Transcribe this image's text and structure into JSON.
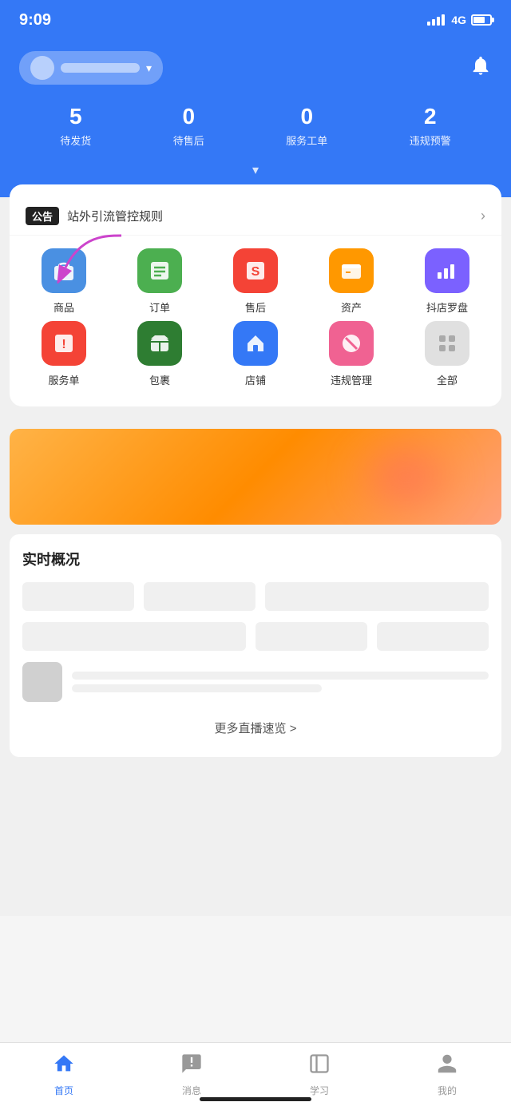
{
  "statusBar": {
    "time": "9:09",
    "signal": "4G"
  },
  "header": {
    "storeName": "",
    "bellLabel": "notifications",
    "stats": [
      {
        "number": "5",
        "label": "待发货"
      },
      {
        "number": "0",
        "label": "待售后"
      },
      {
        "number": "0",
        "label": "服务工单"
      },
      {
        "number": "2",
        "label": "违规预警"
      }
    ],
    "expandLabel": "展开"
  },
  "announcement": {
    "badge": "公告",
    "text": "站外引流管控规则",
    "arrowLabel": ">"
  },
  "menuItems": [
    {
      "id": "goods",
      "label": "商品",
      "iconColor": "blue",
      "iconType": "bag"
    },
    {
      "id": "orders",
      "label": "订单",
      "iconColor": "green",
      "iconType": "list"
    },
    {
      "id": "aftersale",
      "label": "售后",
      "iconColor": "red",
      "iconType": "refund"
    },
    {
      "id": "assets",
      "label": "资产",
      "iconColor": "orange",
      "iconType": "folder"
    },
    {
      "id": "compass",
      "label": "抖店罗盘",
      "iconColor": "purple",
      "iconType": "chart"
    },
    {
      "id": "service",
      "label": "服务单",
      "iconColor": "pinkred",
      "iconType": "alert"
    },
    {
      "id": "package",
      "label": "包裹",
      "iconColor": "darkgreen",
      "iconType": "package"
    },
    {
      "id": "store",
      "label": "店铺",
      "iconColor": "bluehouse",
      "iconType": "house"
    },
    {
      "id": "violation",
      "label": "违规管理",
      "iconColor": "pinkcircle",
      "iconType": "ban"
    },
    {
      "id": "all",
      "label": "全部",
      "iconColor": "gray",
      "iconType": "grid"
    }
  ],
  "realtimeSection": {
    "title": "实时概况",
    "moreLink": "更多直播速览 >"
  },
  "bottomNav": [
    {
      "id": "home",
      "label": "首页",
      "icon": "⌂",
      "active": true
    },
    {
      "id": "message",
      "label": "消息",
      "icon": "💬",
      "active": false
    },
    {
      "id": "learn",
      "label": "学习",
      "icon": "📖",
      "active": false
    },
    {
      "id": "mine",
      "label": "我的",
      "icon": "👤",
      "active": false
    }
  ]
}
